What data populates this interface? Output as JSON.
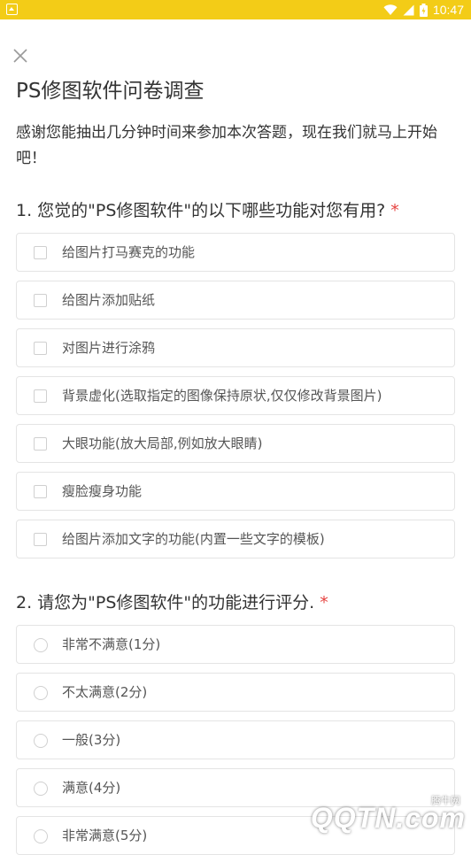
{
  "status_bar": {
    "time": "10:47",
    "bg_color": "#f3cc17"
  },
  "header": {
    "close_icon": "close-icon",
    "title": "PS修图软件问卷调查"
  },
  "intro": "感谢您能抽出几分钟时间来参加本次答题，现在我们就马上开始吧！",
  "questions": [
    {
      "title": "1. 您觉的\"PS修图软件\"的以下哪些功能对您有用?",
      "required_mark": "*",
      "type": "checkbox",
      "options": [
        "给图片打马赛克的功能",
        "给图片添加贴纸",
        "对图片进行涂鸦",
        "背景虚化(选取指定的图像保持原状,仅仅修改背景图片)",
        "大眼功能(放大局部,例如放大眼睛)",
        "瘦脸瘦身功能",
        "给图片添加文字的功能(内置一些文字的模板)"
      ]
    },
    {
      "title": "2. 请您为\"PS修图软件\"的功能进行评分.",
      "required_mark": "*",
      "type": "radio",
      "options": [
        "非常不满意(1分)",
        "不太满意(2分)",
        "一般(3分)",
        "满意(4分)",
        "非常满意(5分)"
      ]
    }
  ],
  "watermark": {
    "site_name": "腾牛网",
    "logo_text": "QQTN.com"
  },
  "colors": {
    "required": "#e64340",
    "border": "#e4e4e4"
  }
}
